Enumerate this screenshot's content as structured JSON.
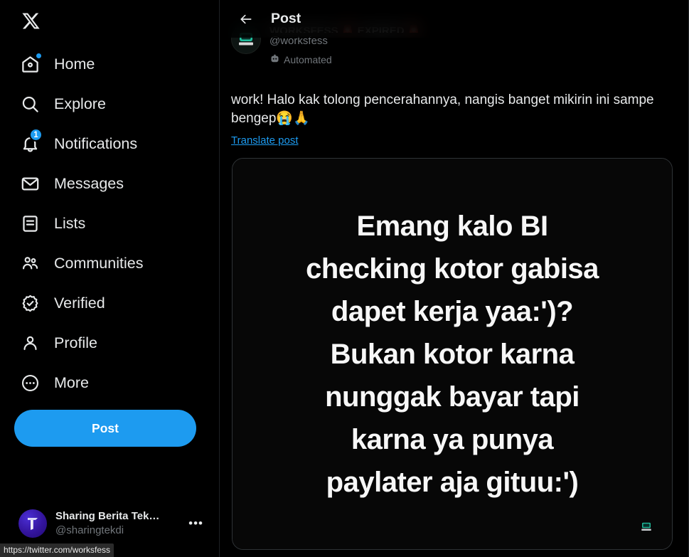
{
  "app": {
    "logo_icon": "x-logo"
  },
  "sidebar": {
    "items": [
      {
        "label": "Home",
        "icon": "home-icon",
        "badge_dot": true
      },
      {
        "label": "Explore",
        "icon": "search-icon"
      },
      {
        "label": "Notifications",
        "icon": "bell-icon",
        "badge_count": "1"
      },
      {
        "label": "Messages",
        "icon": "envelope-icon"
      },
      {
        "label": "Lists",
        "icon": "lists-icon"
      },
      {
        "label": "Communities",
        "icon": "communities-icon"
      },
      {
        "label": "Verified",
        "icon": "verified-badge-icon"
      },
      {
        "label": "Profile",
        "icon": "person-icon"
      },
      {
        "label": "More",
        "icon": "more-circle-icon"
      }
    ],
    "post_button_label": "Post",
    "account": {
      "name": "Sharing Berita Tek…",
      "handle": "@sharingtekdi",
      "more_label": "•••"
    }
  },
  "header": {
    "back_icon": "back-arrow-icon",
    "title": "Post"
  },
  "post": {
    "display_name": "WORKSFESS 🚨 EXPIRED 🚨",
    "handle": "@worksfess",
    "automated_label": "Automated",
    "automated_icon": "robot-icon",
    "text": "work! Halo kak tolong pencerahannya, nangis banget mikirin ini sampe bengep",
    "text_emoji": "😭🙏",
    "translate_label": "Translate post",
    "media": {
      "lines": [
        "Emang kalo BI",
        "checking kotor gabisa",
        "dapet kerja yaa:')?",
        "Bukan kotor karna",
        "nunggak bayar tapi",
        "karna ya punya",
        "paylater aja gituu:')"
      ],
      "watermark_icon": "worksfess-watermark-icon"
    }
  },
  "status_bar": {
    "url": "https://twitter.com/worksfess"
  },
  "colors": {
    "accent": "#1d9bf0",
    "background": "#000000",
    "text_primary": "#e7e9ea",
    "text_secondary": "#71767b",
    "border": "#2f3336"
  }
}
